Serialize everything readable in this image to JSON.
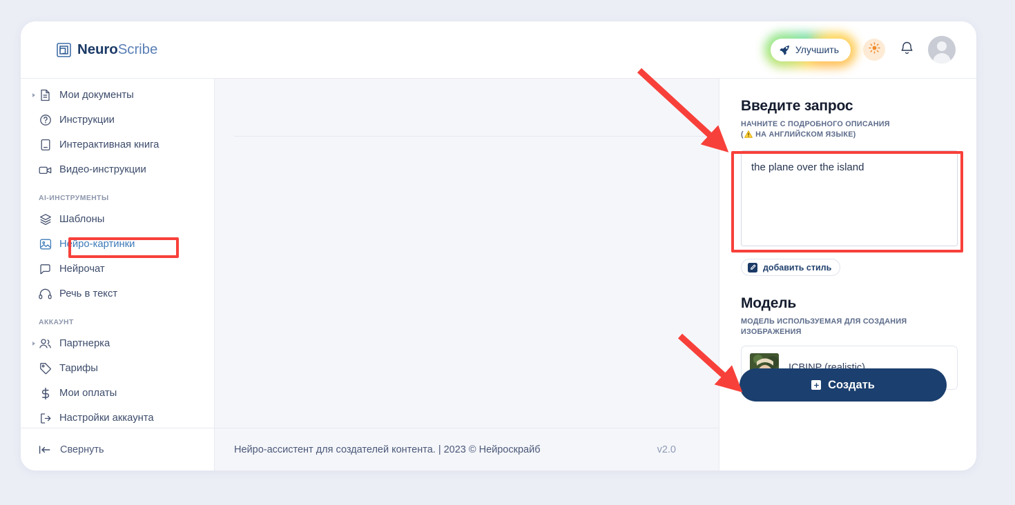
{
  "brand": {
    "name_bold": "Neuro",
    "name_light": "Scribe",
    "logo_icon": "nested-squares-logo-icon"
  },
  "header": {
    "upgrade_label": "Улучшить",
    "upgrade_icon": "rocket-icon",
    "theme_icon": "sun-icon",
    "bell_icon": "bell-icon",
    "avatar_icon": "user-avatar-icon"
  },
  "sidebar": {
    "items": [
      {
        "label": "Мои документы",
        "icon": "document-icon",
        "caret": true,
        "active": false
      },
      {
        "label": "Инструкции",
        "icon": "question-circle-icon",
        "caret": false,
        "active": false
      },
      {
        "label": "Интерактивная книга",
        "icon": "book-icon",
        "caret": false,
        "active": false
      },
      {
        "label": "Видео-инструкции",
        "icon": "video-camera-icon",
        "caret": false,
        "active": false
      }
    ],
    "section_ai": "AI-ИНСТРУМЕНТЫ",
    "ai_items": [
      {
        "label": "Шаблоны",
        "icon": "layers-icon",
        "caret": false,
        "active": false
      },
      {
        "label": "Нейро-картинки",
        "icon": "image-icon",
        "caret": false,
        "active": true
      },
      {
        "label": "Нейрочат",
        "icon": "chat-bubble-icon",
        "caret": false,
        "active": false
      },
      {
        "label": "Речь в текст",
        "icon": "headphones-icon",
        "caret": false,
        "active": false
      }
    ],
    "section_account": "АККАУНТ",
    "account_items": [
      {
        "label": "Партнерка",
        "icon": "users-icon",
        "caret": true,
        "active": false
      },
      {
        "label": "Тарифы",
        "icon": "tag-icon",
        "caret": false,
        "active": false
      },
      {
        "label": "Мои оплаты",
        "icon": "dollar-icon",
        "caret": false,
        "active": false
      },
      {
        "label": "Настройки аккаунта",
        "icon": "logout-icon",
        "caret": false,
        "active": false
      }
    ],
    "collapse_label": "Свернуть",
    "collapse_icon": "collapse-left-icon"
  },
  "panel": {
    "prompt_title": "Введите запрос",
    "prompt_hint_line1": "НАЧНИТЕ С ПОДРОБНОГО ОПИСАНИЯ",
    "prompt_hint_line2_prefix": "(",
    "prompt_hint_line2": "НА АНГЛИЙСКОМ ЯЗЫКЕ)",
    "prompt_hint_icon": "warning-triangle-icon",
    "prompt_value": "the plane over the island",
    "prompt_placeholder": "",
    "style_button_label": "добавить стиль",
    "style_button_icon": "pencil-square-icon",
    "model_title": "Модель",
    "model_subtitle": "МОДЕЛЬ ИСПОЛЬЗУЕМАЯ ДЛЯ СОЗДАНИЯ ИЗОБРАЖЕНИЯ",
    "model_selected": "ICBINP (realistic)",
    "model_thumb_icon": "model-preview-thumbnail",
    "create_button_label": "Создать",
    "create_button_icon": "plus-square-icon"
  },
  "footer": {
    "text": "Нейро-ассистент для создателей контента.  | 2023 © Нейроскрайб",
    "version": "v2.0"
  },
  "colors": {
    "accent_blue": "#1b3f6e",
    "active_item": "#3d7ab8",
    "annotation_red": "#f8403a",
    "page_bg": "#eceef6",
    "panel_bg": "#f5f6fa"
  }
}
